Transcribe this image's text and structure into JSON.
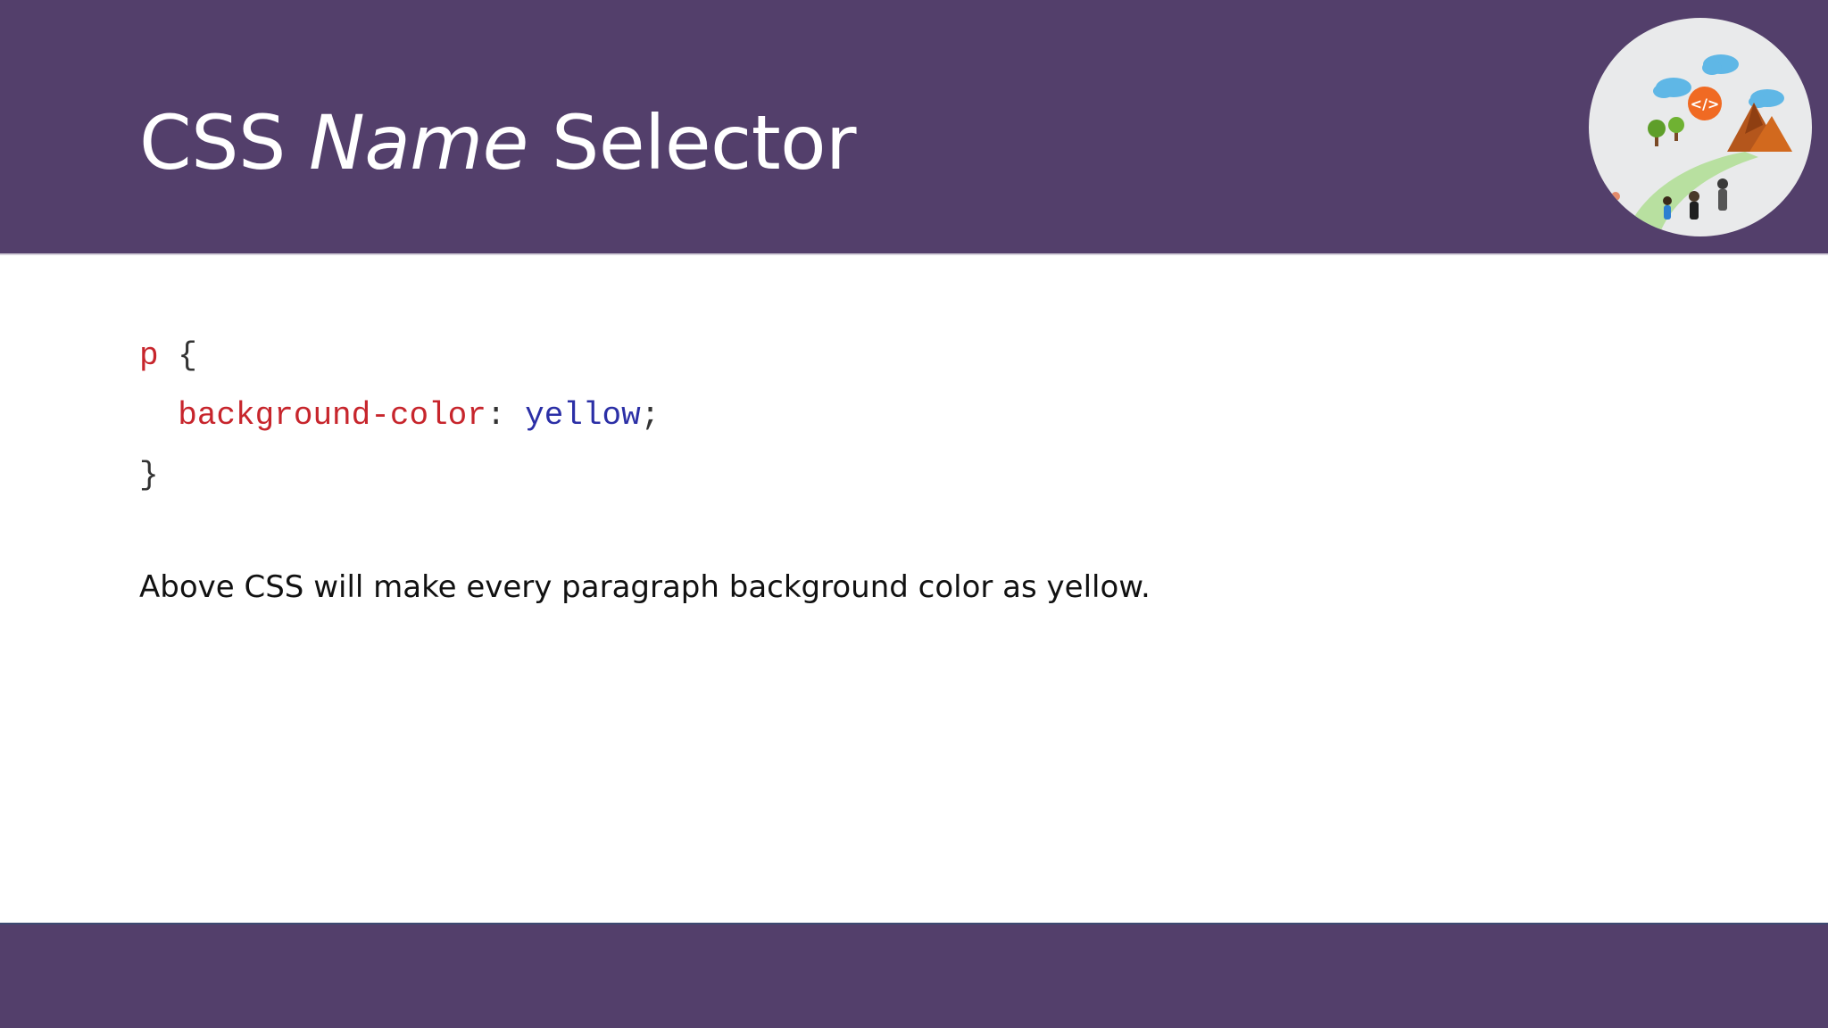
{
  "slide": {
    "title_prefix": "CSS ",
    "title_emphasis": "Name",
    "title_suffix": " Selector",
    "code": {
      "selector": "p",
      "open_brace": "{",
      "property": "background-color",
      "colon": ":",
      "value": "yellow",
      "semicolon": ";",
      "close_brace": "}"
    },
    "description": "Above CSS will make every paragraph background color as yellow."
  },
  "colors": {
    "header_bg": "#533f6b",
    "footer_bg": "#533f6b",
    "code_selector": "#c7252c",
    "code_property": "#c7252c",
    "code_value": "#2b2fa6"
  },
  "icons": {
    "logo": "coding-journey-logo-icon"
  }
}
